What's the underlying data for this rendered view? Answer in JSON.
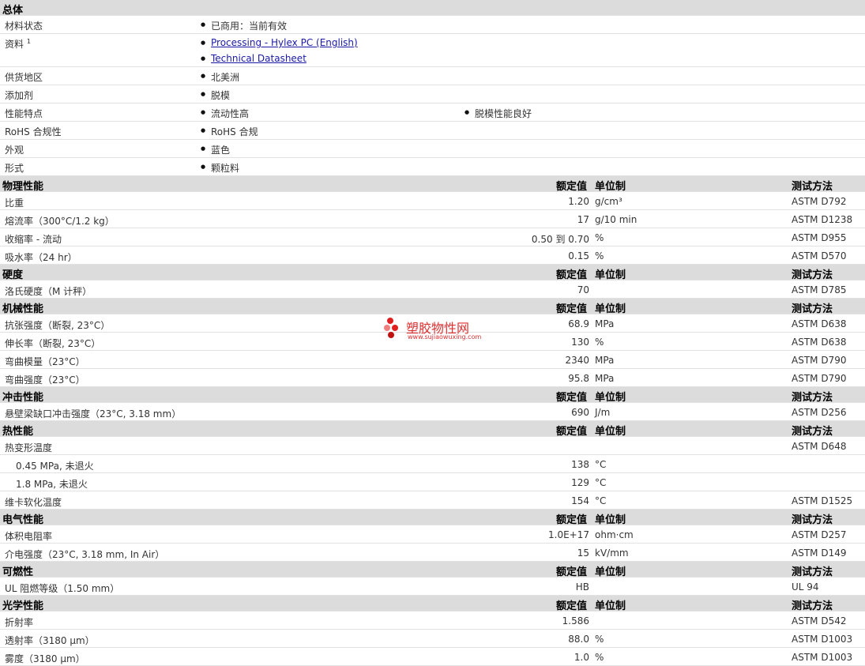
{
  "general": {
    "title": "总体",
    "material_status_label": "材料状态",
    "material_status": "已商用：当前有效",
    "docs_label": "资料",
    "docs_sup": "1",
    "doc1": "Processing - Hylex PC (English)",
    "doc2": "Technical Datasheet",
    "region_label": "供货地区",
    "region": "北美洲",
    "additive_label": "添加剂",
    "additive": "脱模",
    "features_label": "性能特点",
    "feature1": "流动性高",
    "feature2": "脱模性能良好",
    "rohs_label": "RoHS 合规性",
    "rohs": "RoHS 合规",
    "appearance_label": "外观",
    "appearance": "蓝色",
    "form_label": "形式",
    "form": "颗粒料"
  },
  "cols": {
    "value": "额定值",
    "unit": "单位制",
    "method": "测试方法"
  },
  "sections": [
    {
      "title": "物理性能",
      "rows": [
        {
          "name": "比重",
          "value": "1.20",
          "unit": "g/cm³",
          "method": "ASTM D792"
        },
        {
          "name": "熔流率（300°C/1.2 kg）",
          "value": "17",
          "unit": "g/10 min",
          "method": "ASTM D1238"
        },
        {
          "name": "收缩率 - 流动",
          "value": "0.50 到  0.70",
          "unit": "%",
          "method": "ASTM D955"
        },
        {
          "name": "吸水率（24 hr）",
          "value": "0.15",
          "unit": "%",
          "method": "ASTM D570"
        }
      ]
    },
    {
      "title": "硬度",
      "rows": [
        {
          "name": "洛氏硬度（M 计秤）",
          "value": "70",
          "unit": "",
          "method": "ASTM D785"
        }
      ]
    },
    {
      "title": "机械性能",
      "rows": [
        {
          "name": "抗张强度（断裂, 23°C）",
          "value": "68.9",
          "unit": "MPa",
          "method": "ASTM D638"
        },
        {
          "name": "伸长率（断裂, 23°C）",
          "value": "130",
          "unit": "%",
          "method": "ASTM D638"
        },
        {
          "name": "弯曲模量（23°C）",
          "value": "2340",
          "unit": "MPa",
          "method": "ASTM D790"
        },
        {
          "name": "弯曲强度（23°C）",
          "value": "95.8",
          "unit": "MPa",
          "method": "ASTM D790"
        }
      ]
    },
    {
      "title": "冲击性能",
      "rows": [
        {
          "name": "悬壁梁缺口冲击强度（23°C, 3.18 mm）",
          "value": "690",
          "unit": "J/m",
          "method": "ASTM D256"
        }
      ]
    },
    {
      "title": "热性能",
      "rows": [
        {
          "name": "热变形温度",
          "value": "",
          "unit": "",
          "method": "ASTM D648"
        },
        {
          "name": "0.45 MPa, 未退火",
          "value": "138",
          "unit": "°C",
          "method": "",
          "sub": true
        },
        {
          "name": "1.8 MPa, 未退火",
          "value": "129",
          "unit": "°C",
          "method": "",
          "sub": true
        },
        {
          "name": "维卡软化温度",
          "value": "154",
          "unit": "°C",
          "method": "ASTM D1525"
        }
      ]
    },
    {
      "title": "电气性能",
      "rows": [
        {
          "name": "体积电阻率",
          "value": "1.0E+17",
          "unit": "ohm·cm",
          "method": "ASTM D257"
        },
        {
          "name": "介电强度（23°C, 3.18 mm, In Air）",
          "value": "15",
          "unit": "kV/mm",
          "method": "ASTM D149"
        }
      ]
    },
    {
      "title": "可燃性",
      "rows": [
        {
          "name": "UL 阻燃等级（1.50 mm）",
          "value": "HB",
          "unit": "",
          "method": "UL 94"
        }
      ]
    },
    {
      "title": "光学性能",
      "rows": [
        {
          "name": "折射率",
          "value": "1.586",
          "unit": "",
          "method": "ASTM D542"
        },
        {
          "name": "透射率（3180 µm）",
          "value": "88.0",
          "unit": "%",
          "method": "ASTM D1003"
        },
        {
          "name": "雾度（3180 µm）",
          "value": "1.0",
          "unit": "%",
          "method": "ASTM D1003"
        }
      ]
    }
  ],
  "watermark": {
    "title": "塑胶物性网",
    "url": "www.sujiaowuxing.com"
  }
}
